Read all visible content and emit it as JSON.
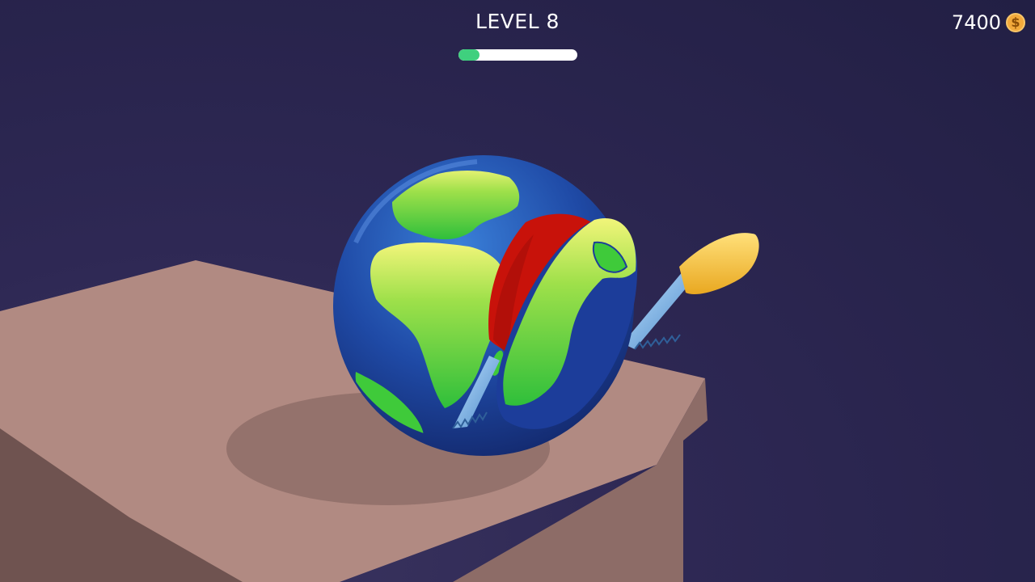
{
  "hud": {
    "level_label": "LEVEL 8",
    "progress": 0.18,
    "coins": "7400",
    "coin_symbol": "$"
  },
  "icons": {
    "coin": "dollar-coin-icon",
    "globe": "earth-globe",
    "knife": "serrated-knife"
  },
  "colors": {
    "background": "#2a2650",
    "progress_fill": "#3fd07e",
    "progress_track": "#ffffff",
    "ocean": "#1f3f9e",
    "land": "#3fca3a",
    "land_highlight": "#e9f26a",
    "cut_face": "#c8120a",
    "knife_blade": "#79b7ee",
    "knife_handle": "#f6c443",
    "table": "#a97f78"
  }
}
